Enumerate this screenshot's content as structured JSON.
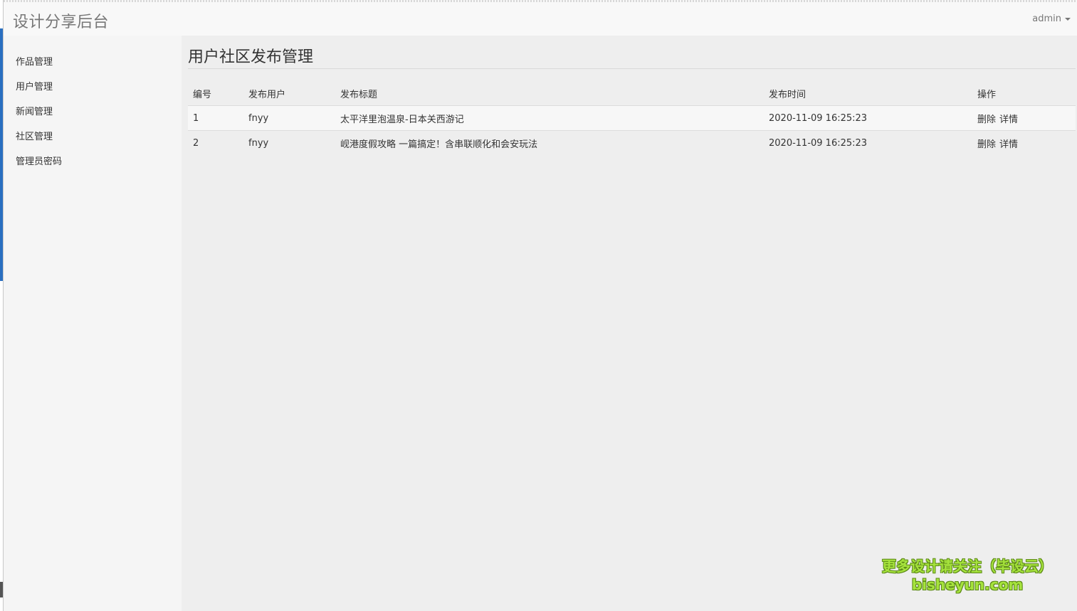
{
  "navbar": {
    "brand": "设计分享后台",
    "user": "admin"
  },
  "sidebar": {
    "items": [
      {
        "label": "作品管理"
      },
      {
        "label": "用户管理"
      },
      {
        "label": "新闻管理"
      },
      {
        "label": "社区管理"
      },
      {
        "label": "管理员密码"
      }
    ]
  },
  "main": {
    "title": "用户社区发布管理",
    "table": {
      "headers": [
        "编号",
        "发布用户",
        "发布标题",
        "发布时间",
        "操作"
      ],
      "rows": [
        {
          "id": "1",
          "user": "fnyy",
          "title": "太平洋里泡温泉-日本关西游记",
          "time": "2020-11-09 16:25:23",
          "delete": "删除",
          "detail": "详情"
        },
        {
          "id": "2",
          "user": "fnyy",
          "title": "岘港度假攻略 一篇搞定！含串联顺化和会安玩法",
          "time": "2020-11-09 16:25:23",
          "delete": "删除",
          "detail": "详情"
        }
      ]
    }
  },
  "watermark": {
    "line1": "更多设计请关注（毕设云）",
    "line2": "bisheyun.com"
  }
}
